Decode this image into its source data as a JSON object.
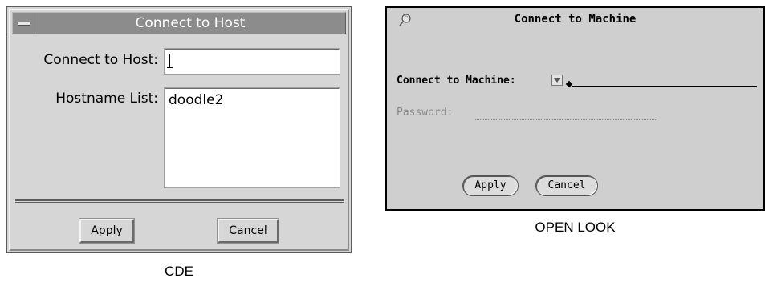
{
  "cde": {
    "title": "Connect to Host",
    "host_label": "Connect to Host:",
    "host_value": "",
    "list_label": "Hostname List:",
    "hostnames": [
      "doodle2"
    ],
    "apply_label": "Apply",
    "cancel_label": "Cancel",
    "caption": "CDE"
  },
  "openlook": {
    "title": "Connect to Machine",
    "machine_label": "Connect to Machine:",
    "password_label": "Password:",
    "apply_label": "Apply",
    "cancel_label": "Cancel",
    "caption": "OPEN LOOK"
  }
}
